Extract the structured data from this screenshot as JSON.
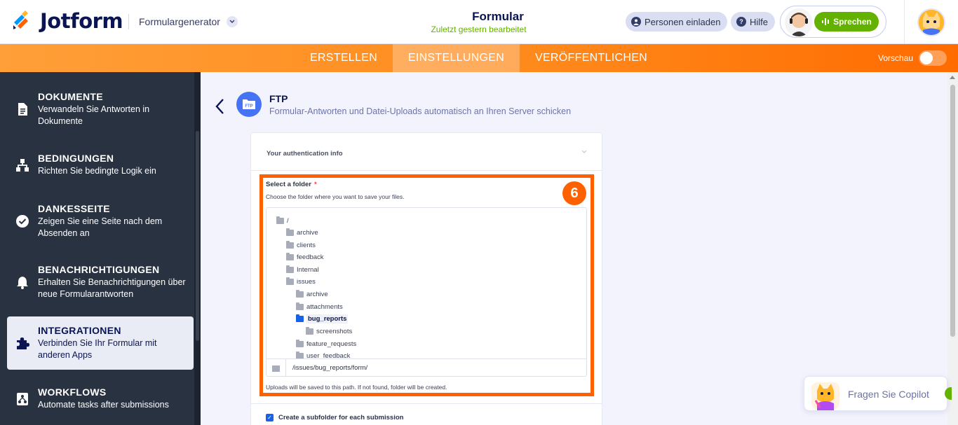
{
  "header": {
    "brand": "Jotform",
    "generator": "Formulargenerator",
    "form_title": "Formular",
    "form_subtitle": "Zuletzt gestern bearbeitet",
    "invite_label": "Personen einladen",
    "help_label": "Hilfe",
    "speak_label": "Sprechen"
  },
  "nav": {
    "tabs": [
      {
        "label": "ERSTELLEN",
        "active": false
      },
      {
        "label": "EINSTELLUNGEN",
        "active": true
      },
      {
        "label": "VERÖFFENTLICHEN",
        "active": false
      }
    ],
    "preview_label": "Vorschau"
  },
  "sidebar": {
    "items": [
      {
        "title": "DOKUMENTE",
        "desc": "Verwandeln Sie Antworten in Dokumente",
        "icon": "document-icon"
      },
      {
        "title": "BEDINGUNGEN",
        "desc": "Richten Sie bedingte Logik ein",
        "icon": "conditions-icon"
      },
      {
        "title": "DANKESSEITE",
        "desc": "Zeigen Sie eine Seite nach dem Absenden an",
        "icon": "check-circle-icon"
      },
      {
        "title": "BENACHRICHTIGUNGEN",
        "desc": "Erhalten Sie Benachrichtigungen über neue Formularantworten",
        "icon": "bell-icon"
      },
      {
        "title": "INTEGRATIONEN",
        "desc": "Verbinden Sie Ihr Formular mit anderen Apps",
        "icon": "puzzle-icon",
        "active": true
      },
      {
        "title": "WORKFLOWS",
        "desc": "Automate tasks after submissions",
        "icon": "workflow-icon"
      }
    ]
  },
  "integration": {
    "name": "FTP",
    "description": "Formular-Antworten und Datei-Uploads automatisch an Ihren Server schicken",
    "icon_text": "FTP",
    "auth_section": "Your authentication info",
    "select_label": "Select a folder",
    "required_mark": "*",
    "select_desc": "Choose the folder where you want to save your files.",
    "step_number": "6",
    "tree": [
      {
        "name": "/",
        "depth": 0
      },
      {
        "name": "archive",
        "depth": 1
      },
      {
        "name": "clients",
        "depth": 1
      },
      {
        "name": "feedback",
        "depth": 1
      },
      {
        "name": "Internal",
        "depth": 1
      },
      {
        "name": "issues",
        "depth": 1
      },
      {
        "name": "archive",
        "depth": 2
      },
      {
        "name": "attachments",
        "depth": 2
      },
      {
        "name": "bug_reports",
        "depth": 2,
        "selected": true
      },
      {
        "name": "screenshots",
        "depth": 3
      },
      {
        "name": "feature_requests",
        "depth": 2
      },
      {
        "name": "user_feedback",
        "depth": 2
      }
    ],
    "path_value": "/issues/bug_reports/form/",
    "uploads_note": "Uploads will be saved to this path. If not found, folder will be created.",
    "subfolder_label": "Create a subfolder for each submission",
    "subfolder_checked": true
  },
  "copilot": {
    "label": "Fragen Sie Copilot"
  },
  "colors": {
    "accent_orange": "#ff6100",
    "nav_orange": "#ff8a1c",
    "sidebar_bg": "#293241",
    "speak_green": "#64b200",
    "ftp_blue": "#4573f4",
    "selected_blue": "#1663ea"
  }
}
